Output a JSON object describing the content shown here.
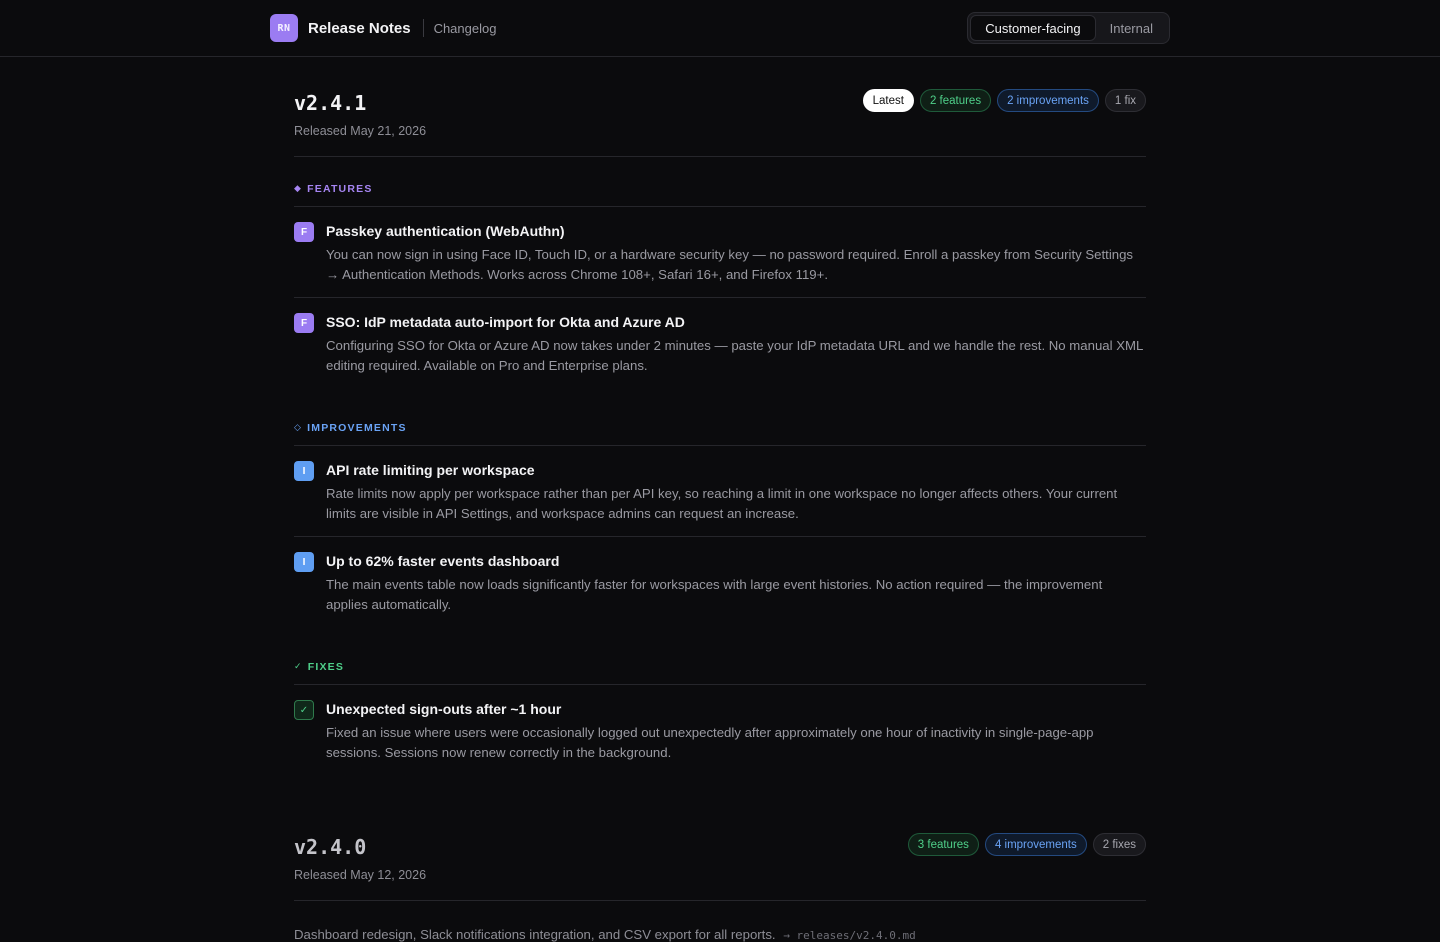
{
  "header": {
    "logo_text": "RN",
    "app_title": "Release Notes",
    "nav_link": "Changelog",
    "segments": [
      "Customer-facing",
      "Internal"
    ]
  },
  "releases": [
    {
      "version": "v2.4.1",
      "date": "Released May 21, 2026",
      "badges": {
        "latest": "Latest",
        "features": "2 features",
        "improvements": "2 improvements",
        "fixes": "1 fix"
      },
      "sections": {
        "features": {
          "symbol": "◆",
          "label": "FEATURES",
          "items": [
            {
              "icon": "F",
              "title": "Passkey authentication (WebAuthn)",
              "desc": "You can now sign in using Face ID, Touch ID, or a hardware security key — no password required. Enroll a passkey from Security Settings → Authentication Methods. Works across Chrome 108+, Safari 16+, and Firefox 119+."
            },
            {
              "icon": "F",
              "title": "SSO: IdP metadata auto-import for Okta and Azure AD",
              "desc": "Configuring SSO for Okta or Azure AD now takes under 2 minutes — paste your IdP metadata URL and we handle the rest. No manual XML editing required. Available on Pro and Enterprise plans."
            }
          ]
        },
        "improvements": {
          "symbol": "◇",
          "label": "IMPROVEMENTS",
          "items": [
            {
              "icon": "I",
              "title": "API rate limiting per workspace",
              "desc": "Rate limits now apply per workspace rather than per API key, so reaching a limit in one workspace no longer affects others. Your current limits are visible in API Settings, and workspace admins can request an increase."
            },
            {
              "icon": "I",
              "title": "Up to 62% faster events dashboard",
              "desc": "The main events table now loads significantly faster for workspaces with large event histories. No action required — the improvement applies automatically."
            }
          ]
        },
        "fixes": {
          "symbol": "✓",
          "label": "FIXES",
          "items": [
            {
              "icon": "✓",
              "title": "Unexpected sign-outs after ~1 hour",
              "desc": "Fixed an issue where users were occasionally logged out unexpectedly after approximately one hour of inactivity in single-page-app sessions. Sessions now renew correctly in the background."
            }
          ]
        }
      }
    },
    {
      "version": "v2.4.0",
      "date": "Released May 12, 2026",
      "badges": {
        "features": "3 features",
        "improvements": "4 improvements",
        "fixes": "2 fixes"
      },
      "summary": "Dashboard redesign, Slack notifications integration, and CSV export for all reports.",
      "summary_link": "→ releases/v2.4.0.md"
    }
  ]
}
